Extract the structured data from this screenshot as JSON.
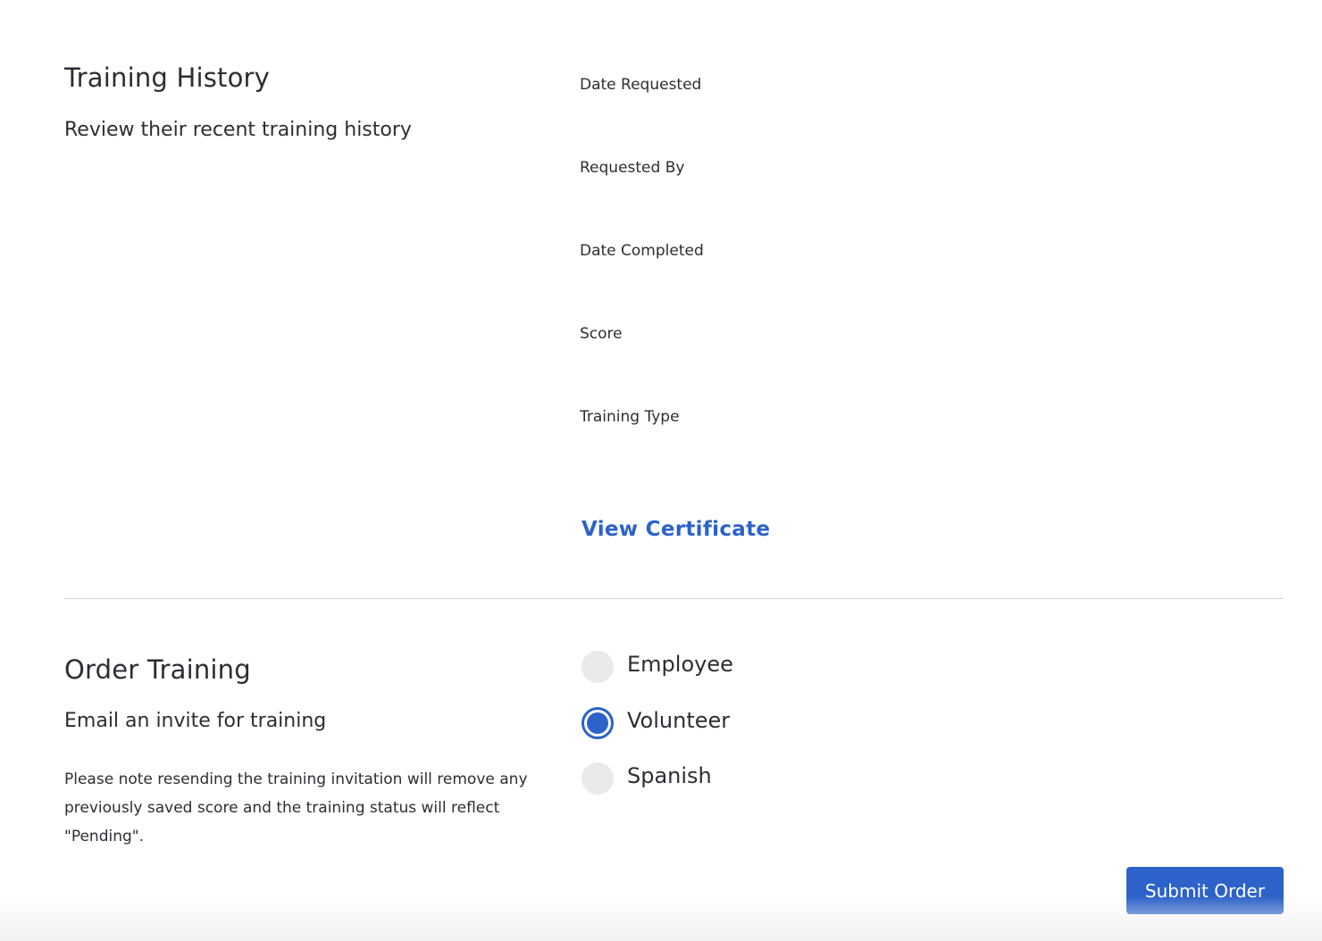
{
  "training_history": {
    "title": "Training History",
    "subtitle": "Review their recent training history",
    "fields": [
      {
        "label": "Date Requested"
      },
      {
        "label": "Requested By"
      },
      {
        "label": "Date Completed"
      },
      {
        "label": "Score"
      },
      {
        "label": "Training Type"
      }
    ],
    "view_certificate_label": "View Certificate"
  },
  "order_training": {
    "title": "Order Training",
    "subtitle": "Email an invite for training",
    "note": "Please note resending the training invitation will remove any previously saved score and the training status will reflect \"Pending\".",
    "options": [
      {
        "label": "Employee",
        "checked": false
      },
      {
        "label": "Volunteer",
        "checked": true
      },
      {
        "label": "Spanish",
        "checked": false
      }
    ],
    "submit_label": "Submit Order"
  },
  "colors": {
    "accent": "#2c62c9",
    "text": "#2b2e33",
    "radio_unchecked": "#eaeaeb",
    "divider": "#d2d2d2"
  }
}
